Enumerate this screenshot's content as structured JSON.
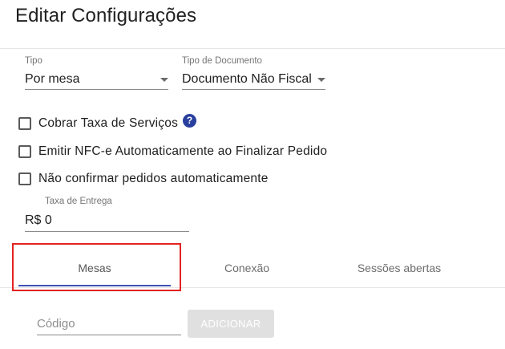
{
  "dialog": {
    "title": "Editar Configurações"
  },
  "tipo": {
    "label": "Tipo",
    "value": "Por mesa"
  },
  "tipo_documento": {
    "label": "Tipo de Documento",
    "value": "Documento Não Fiscal"
  },
  "options": {
    "cobrar_taxa": {
      "label": "Cobrar Taxa de Serviços",
      "checked": false,
      "help_icon": "question-circle-icon"
    },
    "emitir_nfce": {
      "label": "Emitir NFC-e Automaticamente ao Finalizar Pedido",
      "checked": false
    },
    "nao_confirmar": {
      "label": "Não confirmar pedidos automaticamente",
      "checked": false
    }
  },
  "taxa_entrega": {
    "label": "Taxa de Entrega",
    "value": "R$ 0"
  },
  "tabs": [
    {
      "label": "Mesas",
      "active": true
    },
    {
      "label": "Conexão",
      "active": false
    },
    {
      "label": "Sessões abertas",
      "active": false
    }
  ],
  "codigo": {
    "placeholder": "Código",
    "value": ""
  },
  "add_button": {
    "label": "ADICIONAR",
    "disabled": true
  },
  "colors": {
    "accent": "#3f51b5",
    "highlight": "#e32222",
    "help_icon": "#283f9e"
  }
}
